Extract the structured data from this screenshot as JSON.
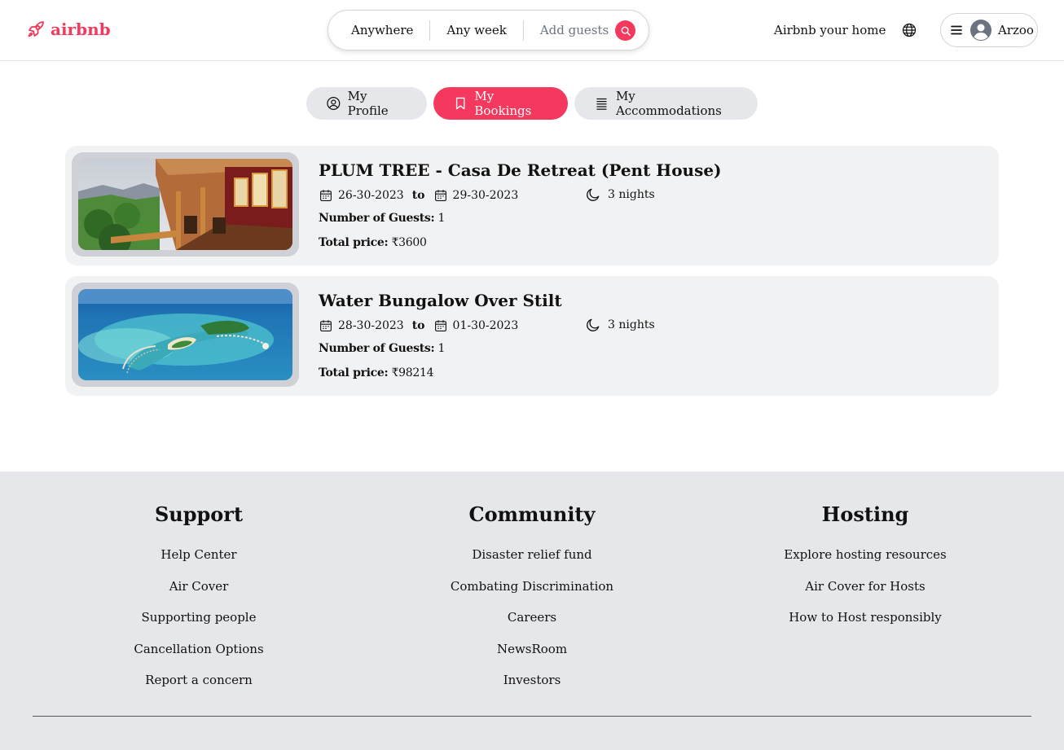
{
  "brand": {
    "name": "airbnb",
    "color": "#f5385d"
  },
  "search": {
    "where": "Anywhere",
    "when": "Any week",
    "guests_placeholder": "Add guests"
  },
  "header": {
    "host_link": "Airbnb your home",
    "user_name": "Arzoo"
  },
  "tabs": [
    {
      "label": "My Profile",
      "icon": "user-circle-icon",
      "active": false
    },
    {
      "label": "My Bookings",
      "icon": "bookmark-icon",
      "active": true
    },
    {
      "label": "My Accommodations",
      "icon": "list-icon",
      "active": false
    }
  ],
  "bookings": [
    {
      "title": "PLUM TREE - Casa De Retreat (Pent House)",
      "check_in": "26-30-2023",
      "to_label": "to",
      "check_out": "29-30-2023",
      "nights": "3 nights",
      "guests_label": "Number of Guests:",
      "guests": "1",
      "price_label": "Total price:",
      "price": "₹3600",
      "image": "mountain-veranda-photo"
    },
    {
      "title": "Water Bungalow Over Stilt",
      "check_in": "28-30-2023",
      "to_label": "to",
      "check_out": "01-30-2023",
      "nights": "3 nights",
      "guests_label": "Number of Guests:",
      "guests": "1",
      "price_label": "Total price:",
      "price": "₹98214",
      "image": "island-resort-photo"
    }
  ],
  "footer": {
    "support": {
      "heading": "Support",
      "links": [
        "Help Center",
        "Air Cover",
        "Supporting people",
        "Cancellation Options",
        "Report a concern"
      ]
    },
    "community": {
      "heading": "Community",
      "links": [
        "Disaster relief fund",
        "Combating Discrimination",
        "Careers",
        "NewsRoom",
        "Investors"
      ]
    },
    "hosting": {
      "heading": "Hosting",
      "links": [
        "Explore hosting resources",
        "Air Cover for Hosts",
        "How to Host responsibly"
      ]
    }
  }
}
